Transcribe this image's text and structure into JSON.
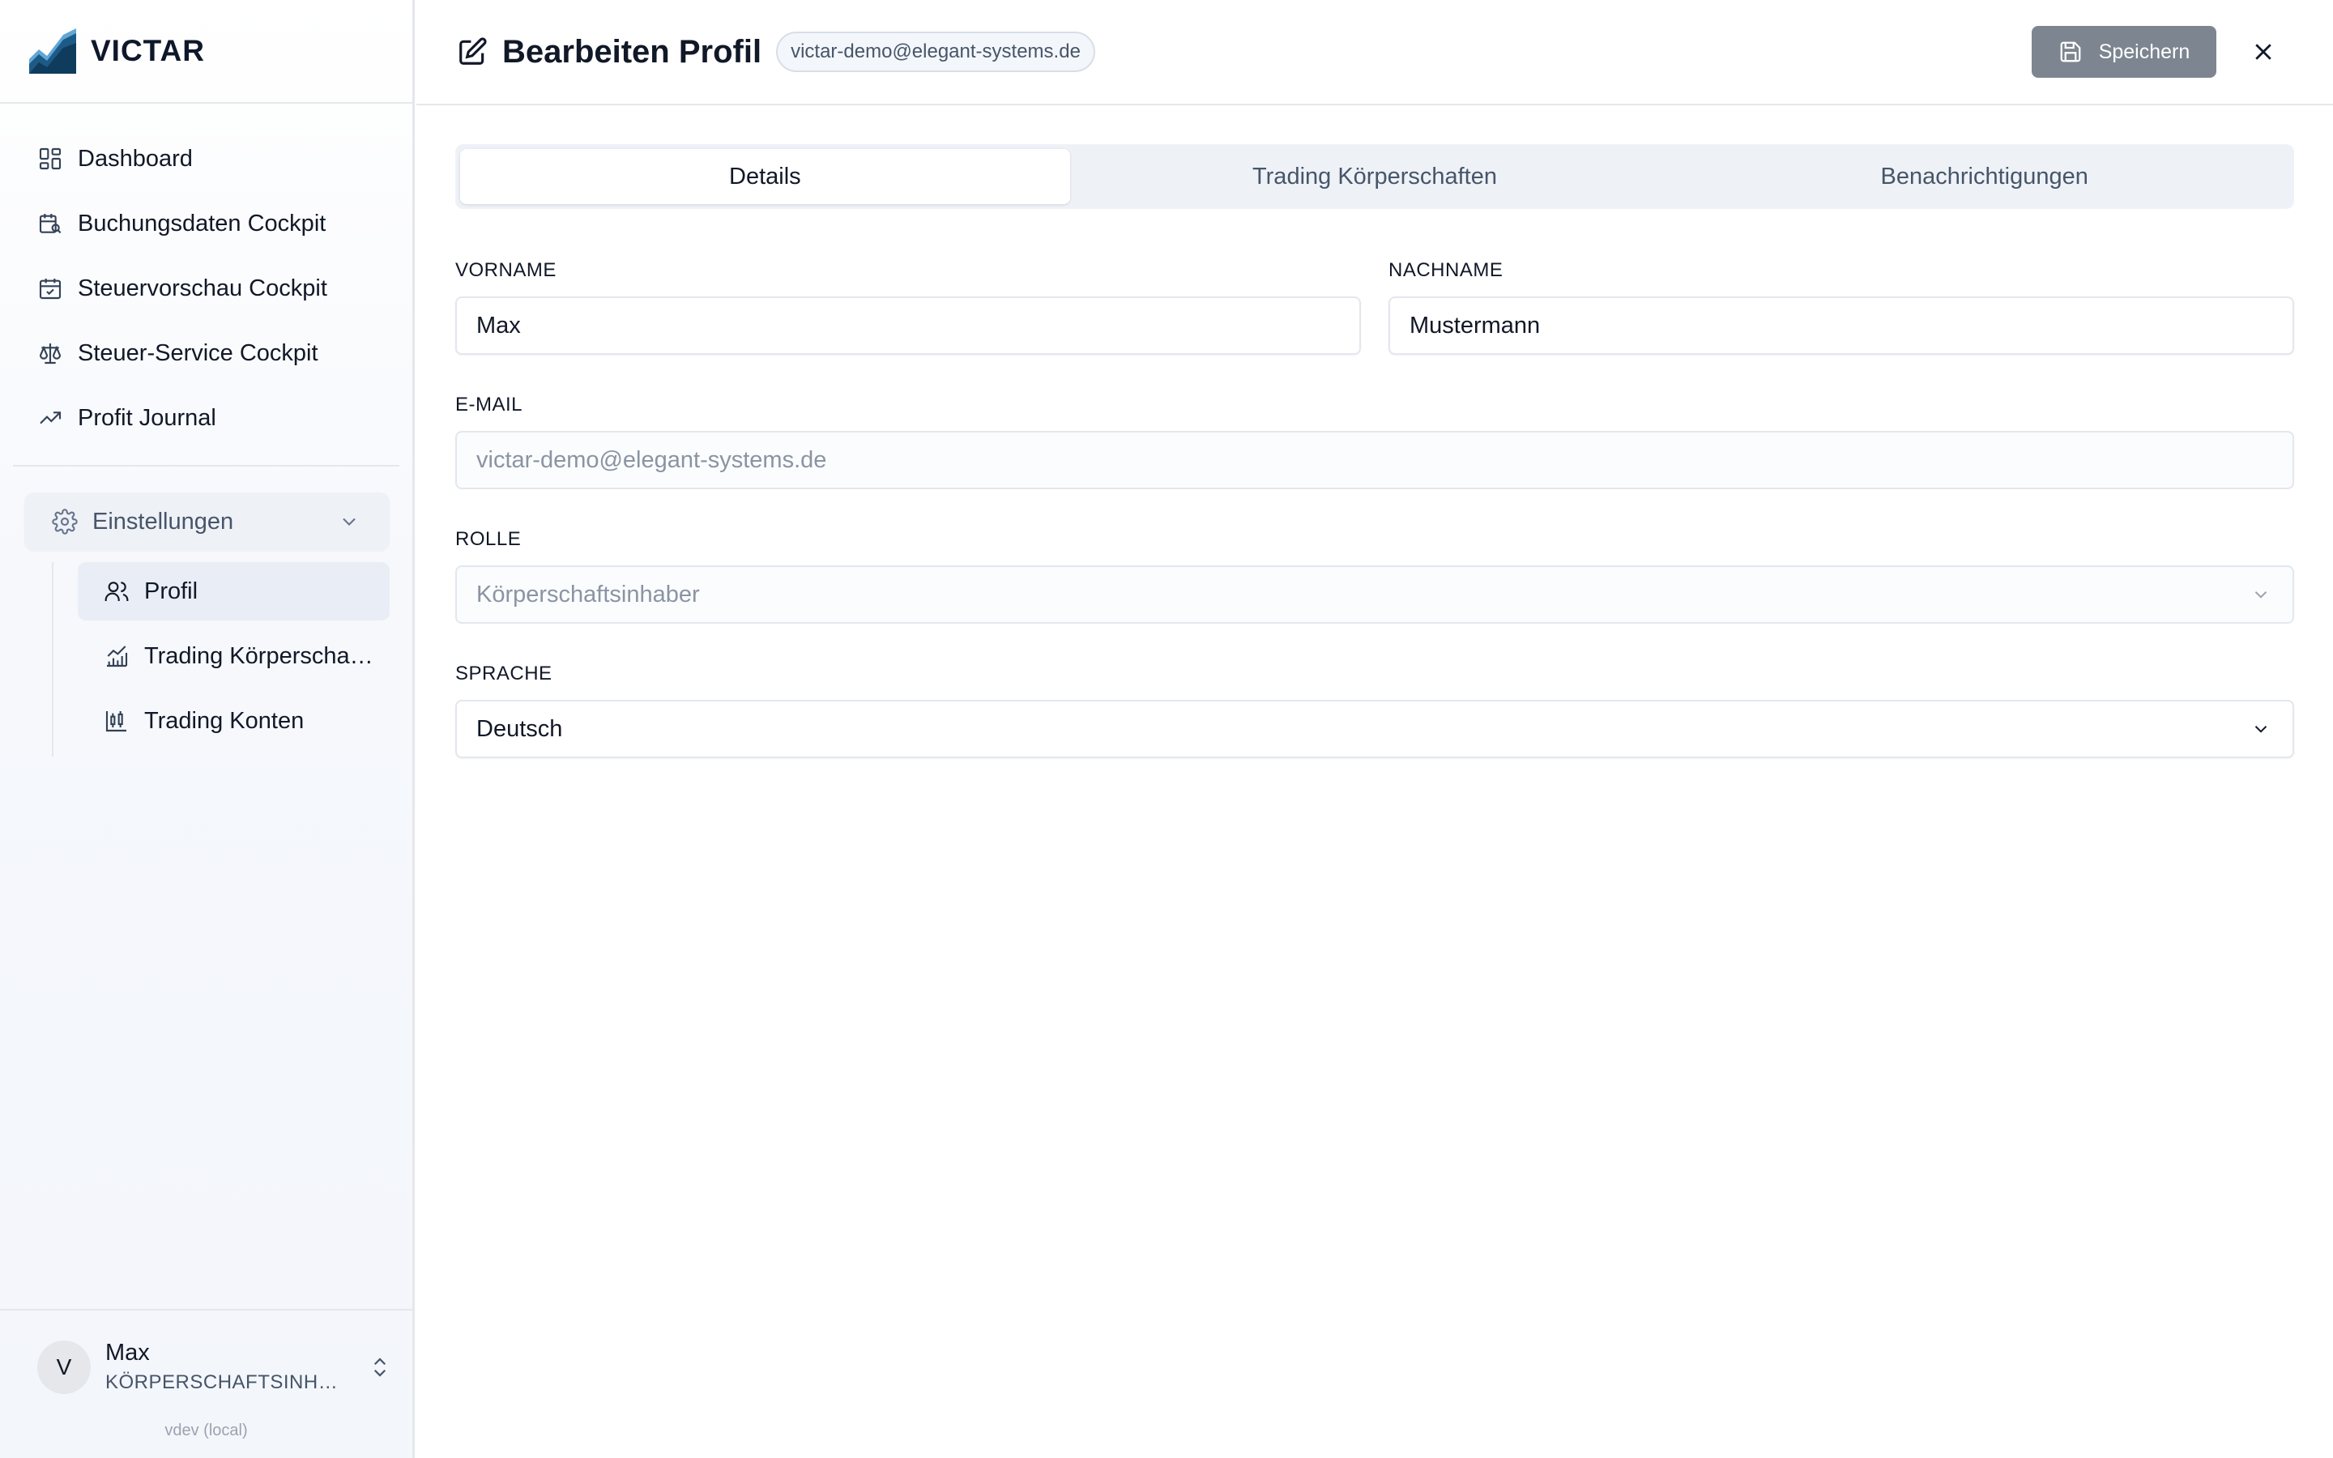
{
  "brand": {
    "name": "VICTAR"
  },
  "sidebar": {
    "items": [
      {
        "label": "Dashboard",
        "icon": "dashboard-grid-icon"
      },
      {
        "label": "Buchungsdaten Cockpit",
        "icon": "calendar-search-icon"
      },
      {
        "label": "Steuervorschau Cockpit",
        "icon": "calendar-check-icon"
      },
      {
        "label": "Steuer-Service Cockpit",
        "icon": "scale-icon"
      },
      {
        "label": "Profit Journal",
        "icon": "trending-up-icon"
      }
    ],
    "settings": {
      "label": "Einstellungen",
      "icon": "gear-icon",
      "children": [
        {
          "label": "Profil",
          "icon": "users-icon",
          "active": true
        },
        {
          "label": "Trading Körperschaften",
          "icon": "bar-chart-trend-icon",
          "active": false
        },
        {
          "label": "Trading Konten",
          "icon": "candlestick-icon",
          "active": false
        }
      ]
    },
    "user": {
      "initial": "V",
      "name": "Max",
      "role": "KÖRPERSCHAFTSINHABER"
    },
    "version": "vdev (local)"
  },
  "header": {
    "title": "Bearbeiten Profil",
    "email_badge": "victar-demo@elegant-systems.de",
    "save_label": "Speichern"
  },
  "tabs": [
    {
      "label": "Details",
      "active": true
    },
    {
      "label": "Trading Körperschaften",
      "active": false
    },
    {
      "label": "Benachrichtigungen",
      "active": false
    }
  ],
  "form": {
    "firstname": {
      "label": "VORNAME",
      "value": "Max"
    },
    "lastname": {
      "label": "NACHNAME",
      "value": "Mustermann"
    },
    "email": {
      "label": "E-MAIL",
      "value": "victar-demo@elegant-systems.de"
    },
    "role": {
      "label": "ROLLE",
      "value": "Körperschaftsinhaber"
    },
    "language": {
      "label": "SPRACHE",
      "value": "Deutsch"
    }
  },
  "colors": {
    "accent": "#1f5f8b",
    "save_button": "#7d8590",
    "tab_bg": "#eef2f7"
  }
}
